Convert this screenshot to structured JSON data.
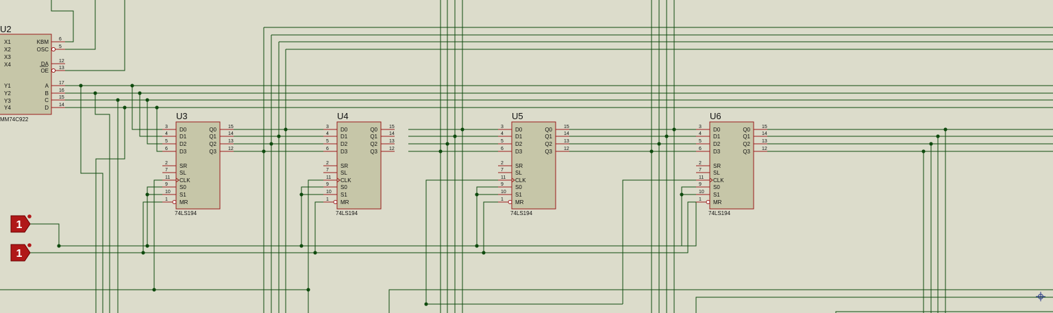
{
  "schematic": {
    "encoder": {
      "ref": "U2",
      "part": "MM74C922",
      "left_pins": [
        "X1",
        "X2",
        "X3",
        "X4",
        "Y1",
        "Y2",
        "Y3",
        "Y4"
      ],
      "right_pins": [
        {
          "name": "KBM",
          "num": "6",
          "inv": false
        },
        {
          "name": "OSC",
          "num": "5",
          "inv": true
        },
        {
          "name": "DA",
          "num": "12",
          "inv": false
        },
        {
          "name": "OE",
          "num": "13",
          "inv": true
        },
        {
          "name": "A",
          "num": "17",
          "inv": false
        },
        {
          "name": "B",
          "num": "16",
          "inv": false
        },
        {
          "name": "C",
          "num": "15",
          "inv": false
        },
        {
          "name": "D",
          "num": "14",
          "inv": false
        }
      ]
    },
    "shift_registers": [
      {
        "ref": "U3",
        "part": "74LS194"
      },
      {
        "ref": "U4",
        "part": "74LS194"
      },
      {
        "ref": "U5",
        "part": "74LS194"
      },
      {
        "ref": "U6",
        "part": "74LS194"
      }
    ],
    "sr_left_pins": [
      {
        "name": "D0",
        "num": "3",
        "inv": false
      },
      {
        "name": "D1",
        "num": "4",
        "inv": false
      },
      {
        "name": "D2",
        "num": "5",
        "inv": false
      },
      {
        "name": "D3",
        "num": "6",
        "inv": false
      },
      {
        "name": "SR",
        "num": "2",
        "inv": false
      },
      {
        "name": "SL",
        "num": "7",
        "inv": false
      },
      {
        "name": "CLK",
        "num": "11",
        "inv": false
      },
      {
        "name": "S0",
        "num": "9",
        "inv": false
      },
      {
        "name": "S1",
        "num": "10",
        "inv": false
      },
      {
        "name": "MR",
        "num": "1",
        "inv": true
      }
    ],
    "sr_right_pins": [
      {
        "name": "Q0",
        "num": "15"
      },
      {
        "name": "Q1",
        "num": "14"
      },
      {
        "name": "Q2",
        "num": "13"
      },
      {
        "name": "Q3",
        "num": "12"
      }
    ],
    "logic_sources": [
      {
        "name": "logic-state-1",
        "value": "1"
      },
      {
        "name": "logic-state-2",
        "value": "1"
      }
    ],
    "colors": {
      "background": "#dcdccb",
      "wire": "#0e4a0e",
      "chip_fill": "#c6c6a8",
      "chip_border": "#9a1a1a",
      "pin": "#9a1a1a",
      "text": "#111111",
      "source_fill": "#b01818"
    }
  }
}
